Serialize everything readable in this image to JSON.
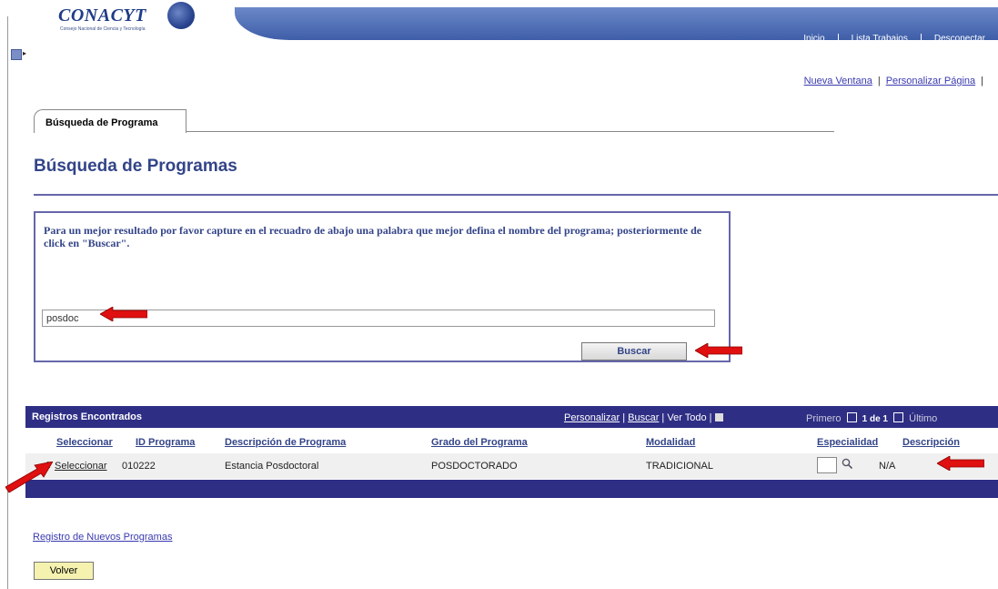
{
  "header": {
    "logo_text": "CONACYT",
    "logo_subtitle": "Consejo Nacional de Ciencia y Tecnología",
    "nav_items": [
      "Inicio",
      "Lista Trabajos",
      "Desconectar"
    ]
  },
  "top_links": {
    "new_window": "Nueva Ventana",
    "personalize": "Personalizar Página",
    "sep": "|"
  },
  "tab": {
    "label": "Búsqueda de Programa"
  },
  "page": {
    "title": "Búsqueda de Programas"
  },
  "search": {
    "instructions": "Para un mejor resultado por favor capture en el recuadro de abajo una palabra que mejor defina el nombre del programa; posteriormente de click en \"Buscar\".",
    "value": "posdoc",
    "button_label": "Buscar"
  },
  "grid": {
    "title": "Registros Encontrados",
    "tools": {
      "personalize": "Personalizar",
      "find": "Buscar",
      "view_all": "Ver Todo"
    },
    "nav": {
      "first": "Primero",
      "counter": "1 de 1",
      "last": "Último"
    },
    "columns": [
      "Seleccionar",
      "ID Programa",
      "Descripción de Programa",
      "Grado del Programa",
      "Modalidad",
      "Especialidad",
      "Descripción"
    ],
    "rows": [
      {
        "num": "1",
        "select": "Seleccionar",
        "id": "010222",
        "description": "Estancia Posdoctoral",
        "grade": "POSDOCTORADO",
        "modality": "TRADICIONAL",
        "specialty": "",
        "spec_description": "N/A"
      }
    ]
  },
  "footer": {
    "register_link": "Registro de Nuevos Programas",
    "back_button": "Volver"
  },
  "colors": {
    "accent": "#334488",
    "grid_header": "#2e2e85",
    "arrow": "#e01010",
    "volver": "#f5f2b0"
  }
}
